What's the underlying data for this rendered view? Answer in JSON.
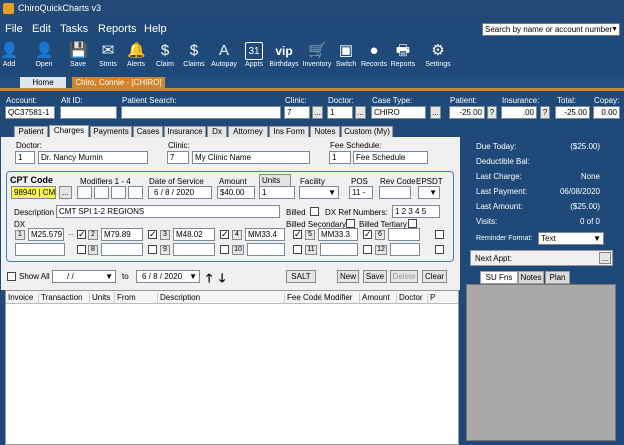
{
  "window": {
    "title": "ChiroQuickCharts v3"
  },
  "search": {
    "placeholder": "Search by name or account number"
  },
  "menu": [
    "File",
    "Edit",
    "Tasks",
    "Reports",
    "Help"
  ],
  "toolbar": [
    {
      "label": "Add",
      "icon": "person-add-icon",
      "glyph": "👤"
    },
    {
      "label": "Open",
      "icon": "person-open-icon",
      "glyph": "👤"
    },
    {
      "label": "Save",
      "icon": "floppy-disk-icon",
      "glyph": "💾"
    },
    {
      "label": "Stmts",
      "icon": "envelope-icon",
      "glyph": "✉"
    },
    {
      "label": "Alerts",
      "icon": "bell-icon",
      "glyph": "🔔"
    },
    {
      "label": "Claim",
      "icon": "dollar-circle-icon",
      "glyph": "$"
    },
    {
      "label": "Claims",
      "icon": "dollar-sign-icon",
      "glyph": "$"
    },
    {
      "label": "Autopay",
      "icon": "autopay-icon",
      "glyph": "A"
    },
    {
      "label": "Appts",
      "icon": "calendar-icon",
      "glyph": "31"
    },
    {
      "label": "Birthdays",
      "icon": "vip-icon",
      "glyph": "vip"
    },
    {
      "label": "Inventory",
      "icon": "cart-icon",
      "glyph": "🛒"
    },
    {
      "label": "Switch",
      "icon": "switch-icon",
      "glyph": "▣"
    },
    {
      "label": "Records",
      "icon": "records-icon",
      "glyph": "●"
    },
    {
      "label": "Reports",
      "icon": "printer-icon",
      "glyph": "🖶"
    },
    {
      "label": "Settings",
      "icon": "gear-icon",
      "glyph": "⚙"
    }
  ],
  "tabs": {
    "home": "Home",
    "patient": "Chiro, Connie - [CHIRO]"
  },
  "header": {
    "account_label": "Account:",
    "account": "QC37581-1",
    "altid_label": "Alt ID:",
    "altid": "",
    "patient_search_label": "Patient Search:",
    "clinic_label": "Clinic:",
    "clinic": "7",
    "doctor_label": "Doctor:",
    "doctor": "1",
    "casetype_label": "Case Type:",
    "casetype": "CHIRO",
    "patient_bal_label": "Patient:",
    "patient_bal": "-25.00",
    "insurance_label": "Insurance:",
    "insurance": ".00",
    "total_label": "Total:",
    "total": "-25.00",
    "copay_label": "Copay:",
    "copay": "0.00",
    "more": "...",
    "help": "?"
  },
  "subtabs": [
    "Patient",
    "Charges",
    "Payments",
    "Cases",
    "Insurance",
    "Dx",
    "Attorney",
    "Ins Form",
    "Notes",
    "Custom (My)"
  ],
  "form": {
    "doctor_label": "Doctor:",
    "doctor_num": "1",
    "doctor_name": "Dr. Nancy Murnin",
    "clinic_label": "Clinic:",
    "clinic_num": "7",
    "clinic_name": "My Clinic Name",
    "fee_label": "Fee Schedule:",
    "fee_num": "1",
    "fee_name": "Fee Schedule",
    "cpt_label": "CPT Code",
    "cpt_value": "98940 | CM",
    "modifiers_label": "Modifiers 1 - 4",
    "dos_label": "Date of Service",
    "dos": "6 / 8 / 2020",
    "amount_label": "Amount",
    "amount": "$40.00",
    "units_label": "Units",
    "units": "1",
    "facility_label": "Facility",
    "pos_label": "POS",
    "pos": "11 -",
    "revcode_label": "Rev Code",
    "epsdt_label": "EPSDT",
    "description_label": "Description",
    "description": "CMT SPI 1-2 REGIONS",
    "billed_label": "Billed",
    "dxref_label": "DX Ref Numbers:",
    "dxref": "1 2 3 4 5",
    "billed_secondary_label": "Billed Secondary",
    "billed_tertiary_label": "Billed Tertiary",
    "dx_label": "DX",
    "dx": [
      {
        "n": "1",
        "code": "M25.579"
      },
      {
        "n": "2",
        "code": "M79.89"
      },
      {
        "n": "3",
        "code": "M48.02"
      },
      {
        "n": "4",
        "code": "MM33.4"
      },
      {
        "n": "5",
        "code": "MM33.3"
      },
      {
        "n": "6",
        "code": ""
      },
      {
        "n": "7",
        "code": ""
      },
      {
        "n": "8",
        "code": ""
      },
      {
        "n": "9",
        "code": ""
      },
      {
        "n": "10",
        "code": ""
      },
      {
        "n": "11",
        "code": ""
      },
      {
        "n": "12",
        "code": ""
      }
    ]
  },
  "filter": {
    "show_all_label": "Show All",
    "from": "/ /",
    "to_label": "to",
    "to": "6 / 8 / 2020",
    "salt": "SALT",
    "new": "New",
    "save": "Save",
    "delete": "Delete",
    "clear": "Clear"
  },
  "grid": {
    "columns": [
      "Invoice",
      "Transaction",
      "Units",
      "From",
      "Description",
      "Fee Code",
      "Modifier",
      "Amount",
      "Doctor",
      "P"
    ]
  },
  "summary": {
    "due_today_label": "Due Today:",
    "due_today": "($25.00)",
    "deductible_label": "Deductible Bal:",
    "deductible": "",
    "last_charge_label": "Last Charge:",
    "last_charge": "None",
    "last_payment_label": "Last Payment:",
    "last_payment": "06/08/2020",
    "last_amount_label": "Last Amount:",
    "last_amount": "($25.00)",
    "visits_label": "Visits:",
    "visits": "0  of  0",
    "reminder_label": "Reminder Format:",
    "reminder": "Text",
    "next_appt_label": "Next Appt:",
    "next_appt_btn": "..."
  },
  "right_tabs": [
    "SU Fns",
    "Notes",
    "Plan"
  ]
}
